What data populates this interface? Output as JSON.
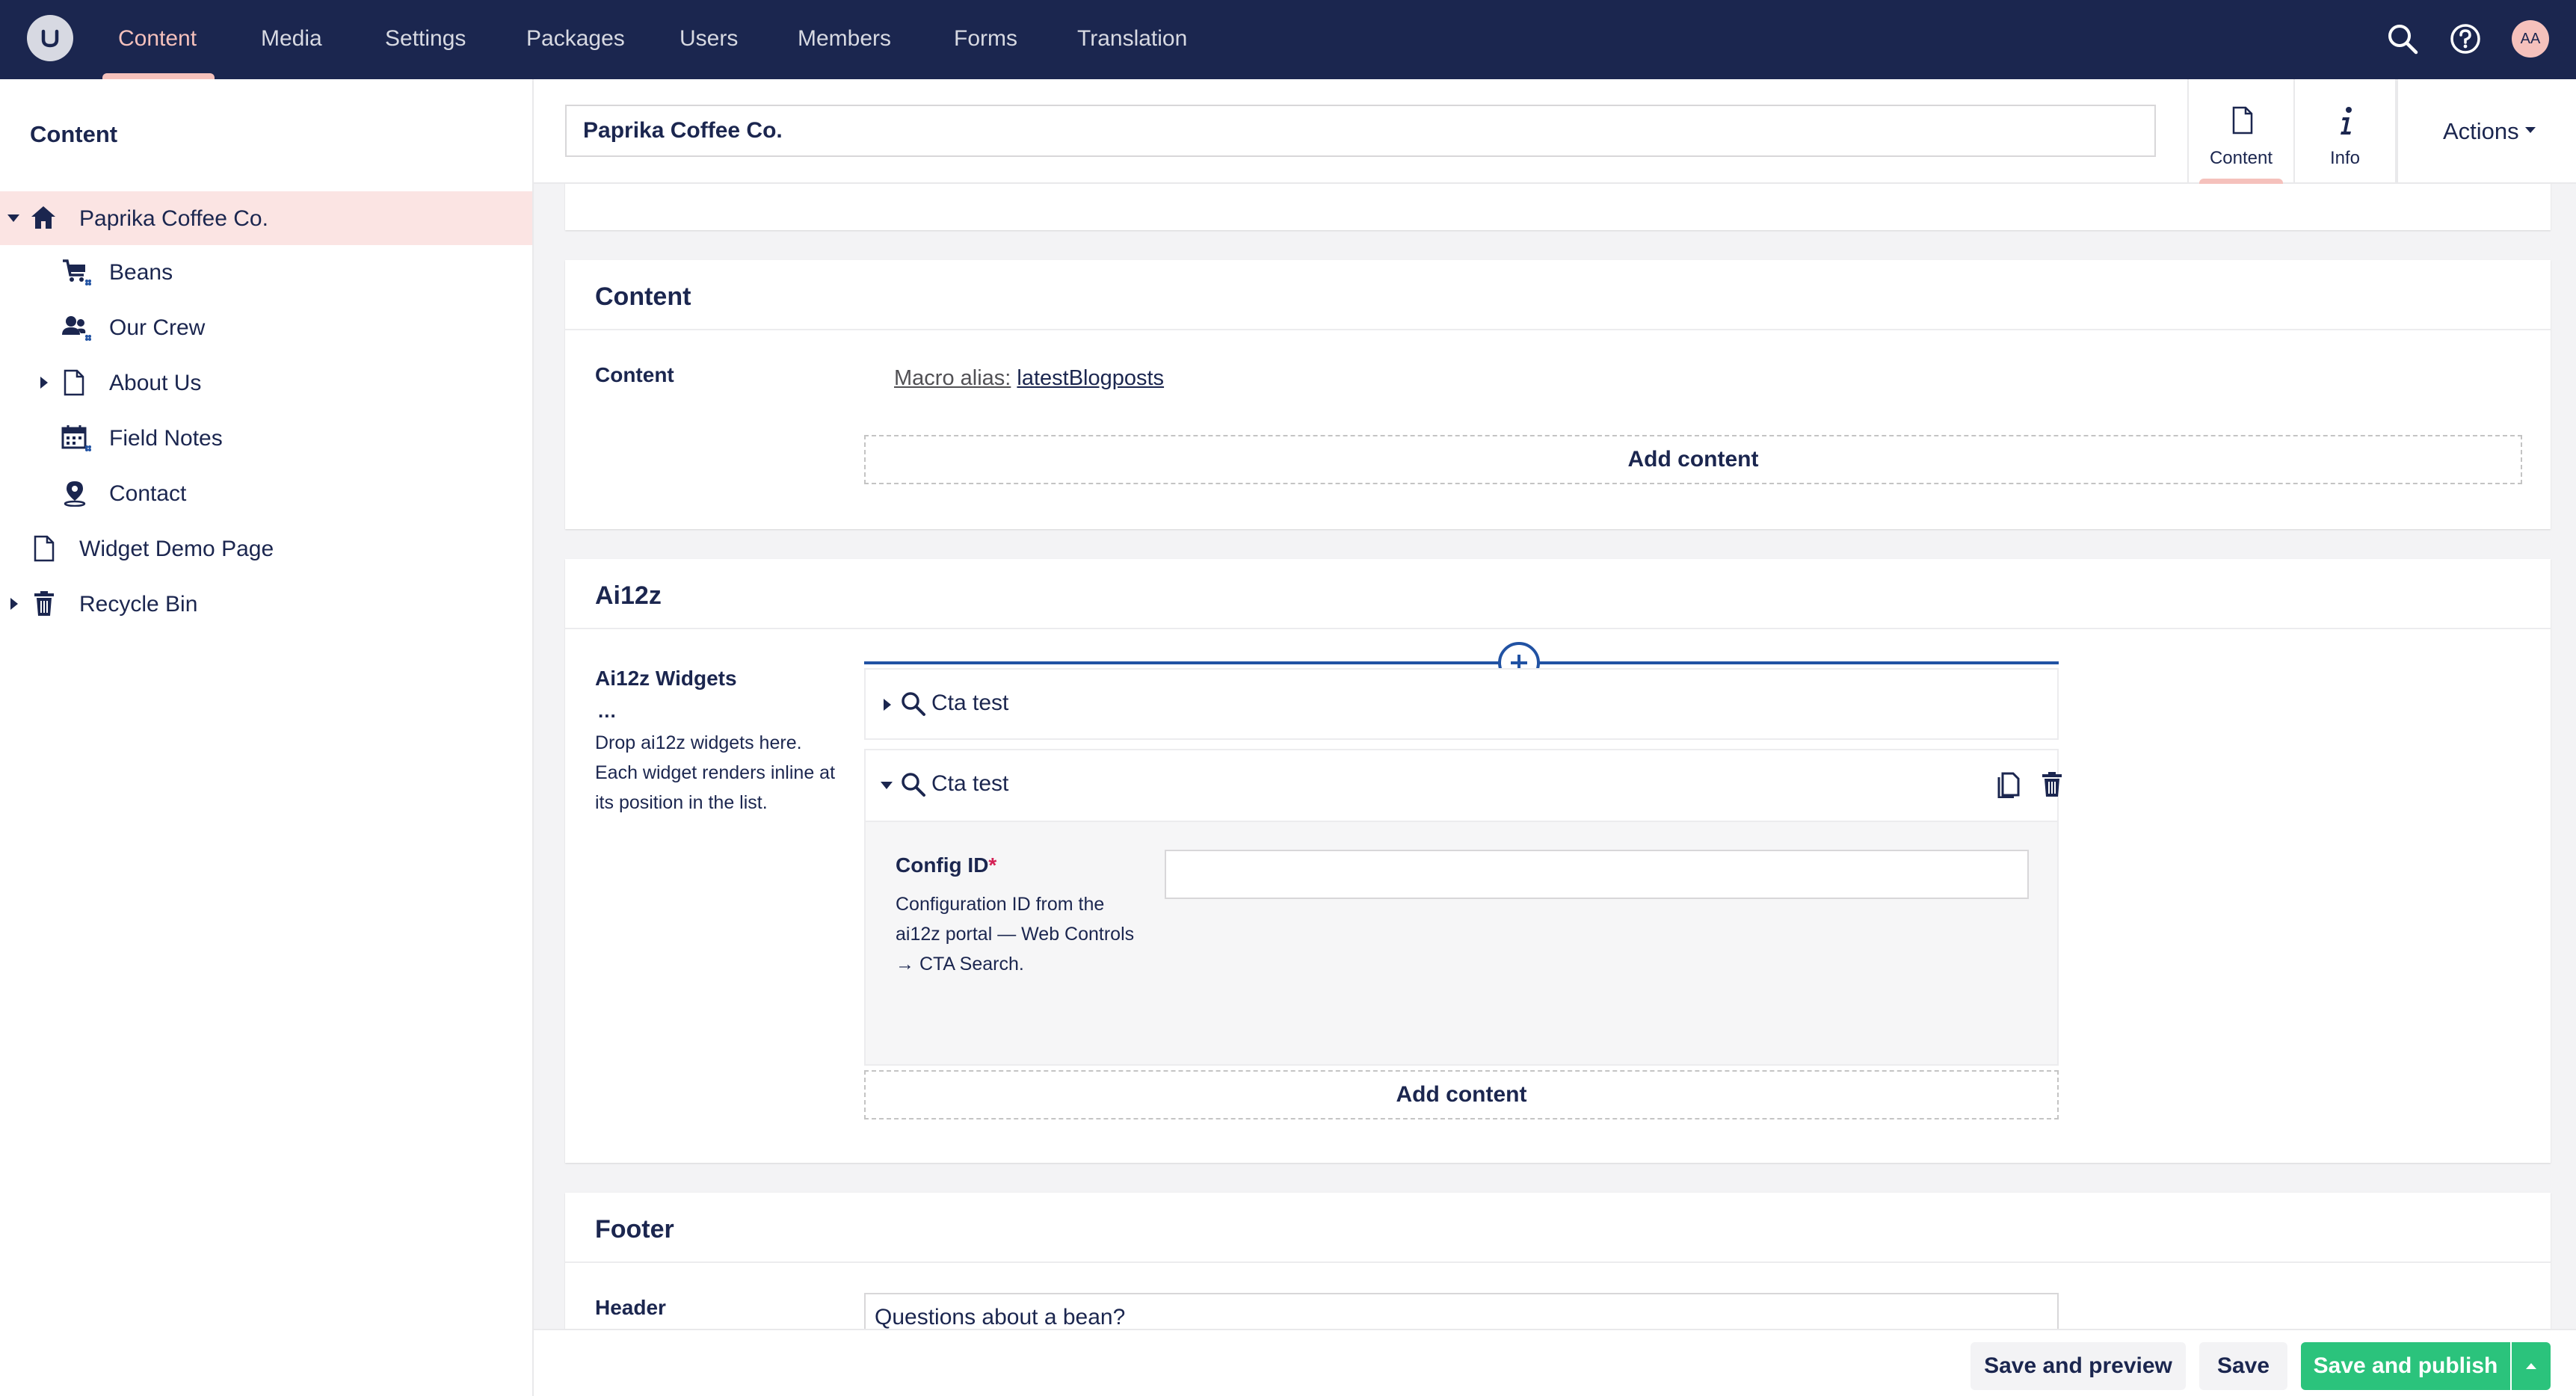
{
  "topnav": {
    "items": [
      "Content",
      "Media",
      "Settings",
      "Packages",
      "Users",
      "Members",
      "Forms",
      "Translation"
    ],
    "active": "Content",
    "avatar_initials": "AA"
  },
  "tree": {
    "title": "Content",
    "items": [
      {
        "label": "Paprika Coffee Co.",
        "icon": "home-icon",
        "caret": "down",
        "selected": true
      },
      {
        "label": "Beans",
        "icon": "shopping-cart-icon"
      },
      {
        "label": "Our Crew",
        "icon": "users-icon"
      },
      {
        "label": "About Us",
        "icon": "document-icon",
        "caret": "right"
      },
      {
        "label": "Field Notes",
        "icon": "calendar-icon"
      },
      {
        "label": "Contact",
        "icon": "map-pin-icon"
      },
      {
        "label": "Widget Demo Page",
        "icon": "document-icon"
      },
      {
        "label": "Recycle Bin",
        "icon": "trash-icon",
        "caret": "right"
      }
    ]
  },
  "editor": {
    "name_value": "Paprika Coffee Co.",
    "apps": [
      {
        "label": "Content",
        "icon": "document-icon",
        "active": true
      },
      {
        "label": "Info",
        "icon": "info-icon"
      }
    ],
    "actions_label": "Actions",
    "partial_url": "/beans/"
  },
  "content_panel": {
    "title": "Content",
    "property_label": "Content",
    "macro_prefix": "Macro alias:",
    "macro_alias": "latestBlogposts",
    "add_content": "Add content"
  },
  "ai_panel": {
    "title": "Ai12z",
    "property_label": "Ai12z Widgets",
    "more": "...",
    "description": "Drop ai12z widgets here. Each widget renders inline at its position in the list.",
    "blocks": [
      {
        "label": "Cta test",
        "expanded": false
      },
      {
        "label": "Cta test",
        "expanded": true
      }
    ],
    "config_label": "Config ID",
    "required_mark": "*",
    "config_desc": "Configuration ID from the ai12z portal — Web Controls → CTA Search.",
    "config_value": "",
    "add_content": "Add content"
  },
  "footer_panel": {
    "title": "Footer",
    "header_label": "Header",
    "header_value": "Questions about a bean?"
  },
  "buttons": {
    "save_preview": "Save and preview",
    "save": "Save",
    "save_publish": "Save and publish"
  },
  "colors": {
    "topbar": "#1b264f",
    "accent": "#f5c1bc",
    "selected_row": "#fbe4e3",
    "publish_green": "#2bc37c",
    "add_line": "#2152a3"
  }
}
